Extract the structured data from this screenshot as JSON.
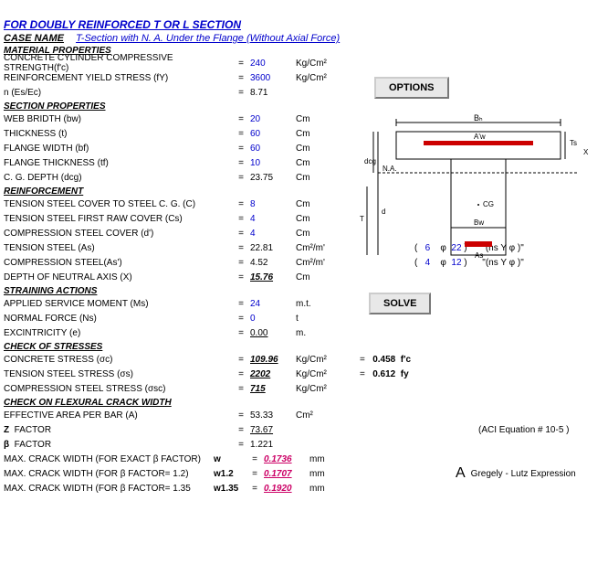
{
  "title_line2": "FOR DOUBLY REINFORCED T OR L SECTION",
  "case_name_label": "CASE NAME",
  "case_name_value": "T-Section with N. A. Under the Flange (Without Axial Force)",
  "sections": {
    "material": "MATERIAL PROPERTIES",
    "secprop": "SECTION PROPERTIES",
    "reinf": "REINFORCEMENT",
    "strain": "STRAINING ACTIONS",
    "chkstr": "CHECK OF STRESSES",
    "chkcrk": "CHECK ON FLEXURAL CRACK WIDTH"
  },
  "mat": {
    "fc_label": "CONCRETE CYLINDER COMPRESSIVE STRENGTH(f'c)",
    "fc": "240",
    "fc_u": "Kg/Cm²",
    "fy_label": "REINFORCEMENT YIELD STRESS (fY)",
    "fy": "3600",
    "fy_u": "Kg/Cm²",
    "n_label": "n  (Es/Ec)",
    "n": "8.71"
  },
  "sec": {
    "bw_label": "WEB BRIDTH (bw)",
    "bw": "20",
    "bw_u": "Cm",
    "t_label": "THICKNESS (t)",
    "t": "60",
    "t_u": "Cm",
    "bf_label": "FLANGE WIDTH (bf)",
    "bf": "60",
    "bf_u": "Cm",
    "tf_label": "FLANGE THICKNESS (tf)",
    "tf": "10",
    "tf_u": "Cm",
    "dcg_label": "C. G. DEPTH (dcg)",
    "dcg": "23.75",
    "dcg_u": "Cm"
  },
  "reinf": {
    "c_label": "TENSION STEEL COVER TO STEEL C. G. (C)",
    "c": "8",
    "c_u": "Cm",
    "cs_label": "TENSION STEEL FIRST RAW COVER (Cs)",
    "cs": "4",
    "cs_u": "Cm",
    "d_label": "COMPRESSION STEEL COVER (d')",
    "d": "4",
    "d_u": "Cm",
    "as_label": "TENSION STEEL (As)",
    "as": "22.81",
    "as_u": "Cm²/m'",
    "asc_label": "COMPRESSION STEEL(As')",
    "asc": "4.52",
    "asc_u": "Cm²/m'",
    "x_label": "DEPTH OF NEUTRAL AXIS (X)",
    "x": "15.76",
    "x_u": "Cm"
  },
  "strain": {
    "ms_label": "APPLIED SERVICE MOMENT (Ms)",
    "ms": "24",
    "ms_u": "m.t.",
    "ns_label": "NORMAL FORCE (Ns)",
    "ns": "0",
    "ns_u": "t",
    "e_label": "EXCINTRICITY (e)",
    "e": "0.00",
    "e_u": "m."
  },
  "stress": {
    "cs_label": "CONCRETE STRESS (σc)",
    "cs": "109.96",
    "cs_u": "Kg/Cm²",
    "cs_r": "0.458",
    "cs_rf": "f'c",
    "ts_label": "TENSION STEEL STRESS (σs)",
    "ts": "2202",
    "ts_u": "Kg/Cm²",
    "ts_r": "0.612",
    "ts_rf": "fy",
    "css_label": "COMPRESSION STEEL STRESS (σsc)",
    "css": "715",
    "css_u": "Kg/Cm²"
  },
  "crack": {
    "a_label": "EFFECTIVE AREA PER BAR (A)",
    "a": "53.33",
    "a_u": "Cm²",
    "z_label": "Z  FACTOR",
    "z": "73.67",
    "b_label": "β  FACTOR",
    "b": "1.221",
    "w_label": "MAX. CRACK WIDTH (FOR EXACT  β  FACTOR)",
    "w_sym": "w",
    "w": "0.1736",
    "w_u": "mm",
    "w12_label": "MAX. CRACK WIDTH (FOR β  FACTOR= 1.2)",
    "w12_sym": "w1.2",
    "w12": "0.1707",
    "w12_u": "mm",
    "w135_label": "MAX. CRACK WIDTH (FOR β  FACTOR= 1.35",
    "w135_sym": "w1.35",
    "w135": "0.1920",
    "w135_u": "mm",
    "aci_note": "(ACI  Equation # 10-5 )",
    "gl_note": "Gregely - Lutz Expression"
  },
  "buttons": {
    "options": "OPTIONS",
    "solve": "SOLVE"
  },
  "steel": {
    "t_n": "6",
    "t_d": "22",
    "t_fmt": "\"(ns  Y   φ   )\"",
    "c_n": "4",
    "c_d": "12",
    "c_fmt": "\"(ns  Y   φ   )\""
  },
  "diag_labels": {
    "bh": "Bₕ",
    "aw": "A'w",
    "ts": "Ts",
    "x": "X",
    "na": "N.A.",
    "t": "T",
    "d": "d",
    "cg": "CG",
    "bw": "Bw",
    "as": "As",
    "dcg": "dcg"
  },
  "A_sym": "A"
}
